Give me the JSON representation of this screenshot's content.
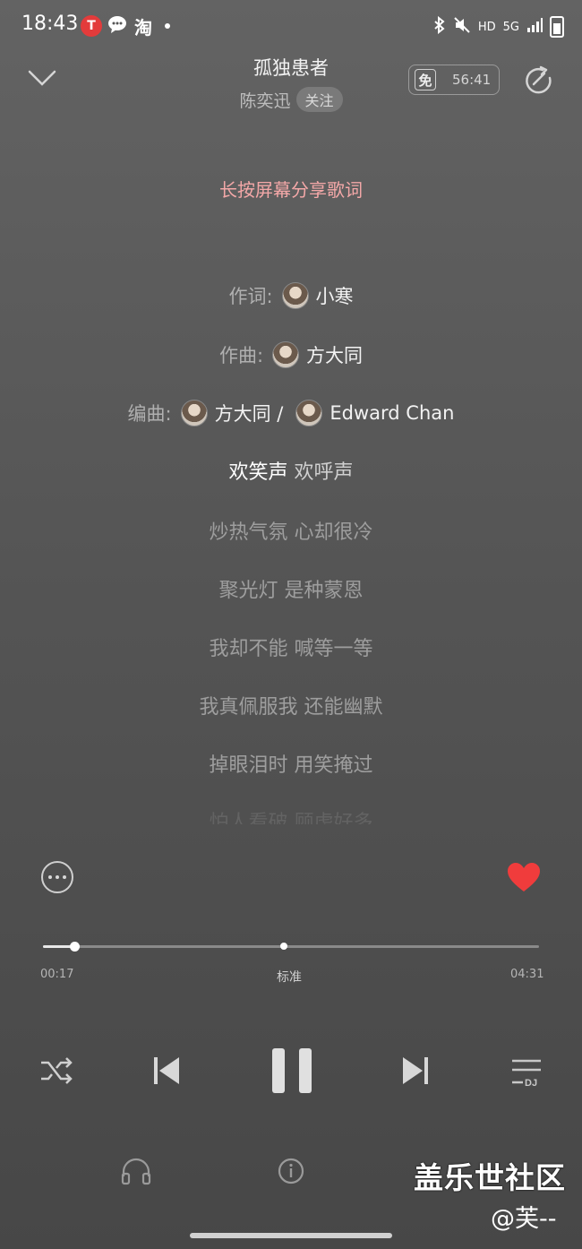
{
  "status_bar": {
    "time": "18:43",
    "tesla_glyph": "T",
    "taobao_glyph": "淘",
    "hd": "HD",
    "network": "5G"
  },
  "header": {
    "song_title": "孤独患者",
    "artist": "陈奕迅",
    "follow_label": "关注",
    "free_tag": "免",
    "free_time": "56:41"
  },
  "share_hint": "长按屏幕分享歌词",
  "credits": {
    "lyricist_label": "作词:",
    "lyricist": "小寒",
    "composer_label": "作曲:",
    "composer": "方大同",
    "arranger_label": "编曲:",
    "arranger_1": "方大同 /",
    "arranger_2": "Edward Chan"
  },
  "lyrics": {
    "current_a": "欢笑声",
    "current_b": "欢呼声",
    "line_1": "炒热气氛 心却很冷",
    "line_2": "聚光灯 是种蒙恩",
    "line_3": "我却不能 喊等一等",
    "line_4": "我真佩服我 还能幽默",
    "line_5": "掉眼泪时 用笑掩过",
    "line_6": "怕人看破 顾虑好多"
  },
  "player": {
    "elapsed": "00:17",
    "quality": "标准",
    "duration": "04:31",
    "progress_fraction": 0.063,
    "liked": true
  },
  "footer": {
    "dj_label": "DJ"
  },
  "watermark": {
    "line1": "盖乐世社区",
    "line2": "@芙--"
  },
  "colors": {
    "accent_red": "#f03c3c",
    "hint_pink": "#f4a8a8"
  }
}
